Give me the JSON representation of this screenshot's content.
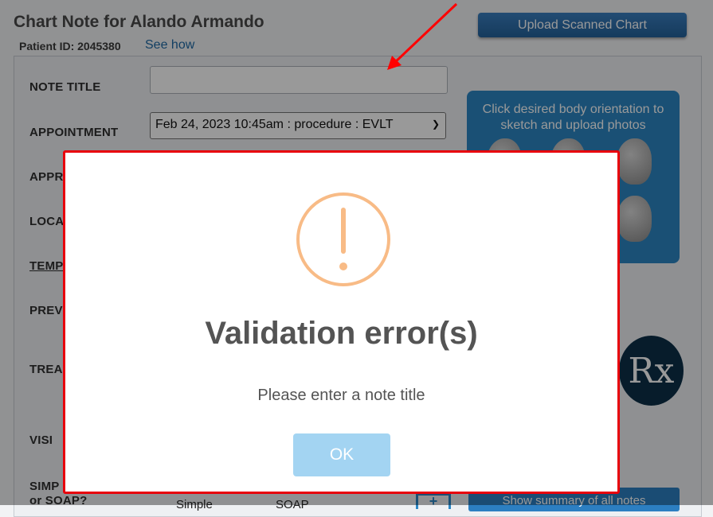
{
  "page": {
    "title": "Chart Note for Alando Armando",
    "patient_id": "Patient ID: 2045380",
    "see_how": "See how",
    "upload_button": "Upload Scanned Chart"
  },
  "form": {
    "labels": {
      "note_title": "NOTE TITLE",
      "appointment": "APPOINTMENT",
      "appr": "APPR",
      "loca": "LOCA",
      "temp": "TEMP",
      "prev": "PREV",
      "trea": "TREA",
      "visi": "VISI",
      "simp": "SIMP",
      "soap_q": "or SOAP?"
    },
    "note_title_value": "",
    "appointment_value": "Feb 24, 2023 10:45am : procedure : EVLT",
    "simple_label": "Simple",
    "soap_label": "SOAP",
    "plus_label": "+",
    "summary_button": "Show summary of all notes"
  },
  "body_orientation": {
    "text": "Click desired body orientation to sketch and upload photos"
  },
  "rx_icon_text": "Rx",
  "modal": {
    "icon": "exclamation-circle-icon",
    "title": "Validation error(s)",
    "message": "Please enter a note title",
    "ok_label": "OK",
    "icon_color": "#f8bb86",
    "border_color": "#e8000b",
    "ok_color": "#a3d4f2"
  }
}
